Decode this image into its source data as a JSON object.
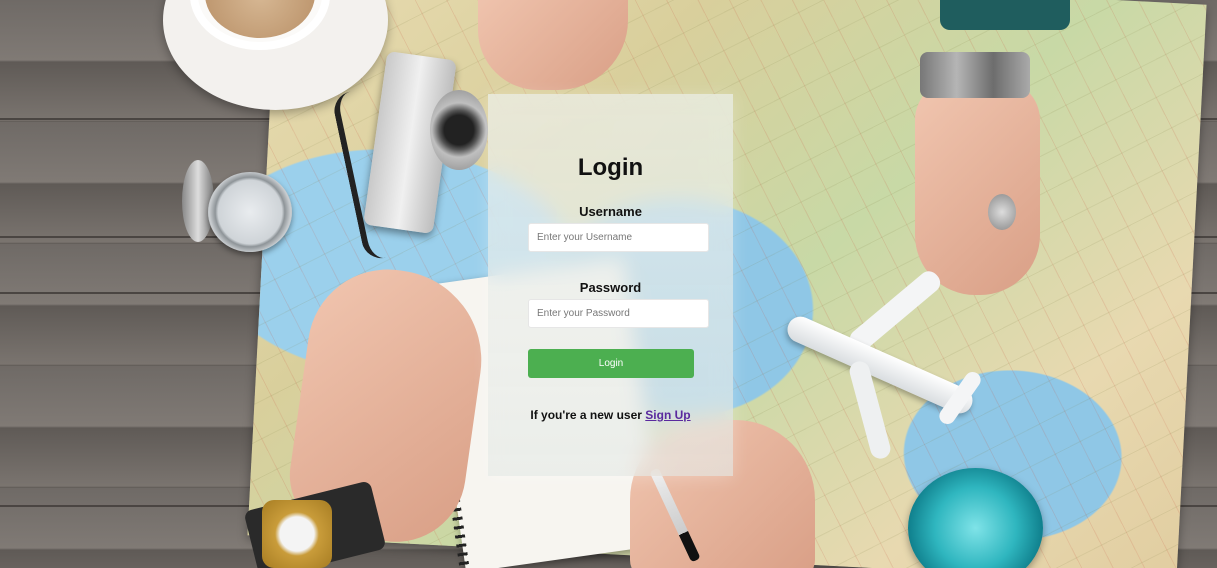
{
  "login": {
    "title": "Login",
    "username": {
      "label": "Username",
      "placeholder": "Enter your Username",
      "value": ""
    },
    "password": {
      "label": "Password",
      "placeholder": "Enter your Password",
      "value": ""
    },
    "submit_label": "Login",
    "signup_prompt": "If you're a new user",
    "signup_link": "Sign Up"
  },
  "colors": {
    "button": "#4caf50",
    "link": "#5a2a9e",
    "card": "rgba(230,236,235,0.55)"
  },
  "background": {
    "icons": [
      "coffee-cup-icon",
      "compass-icon",
      "camera-icon",
      "airplane-icon",
      "watch-icon",
      "glass-icon",
      "map-icon"
    ]
  }
}
